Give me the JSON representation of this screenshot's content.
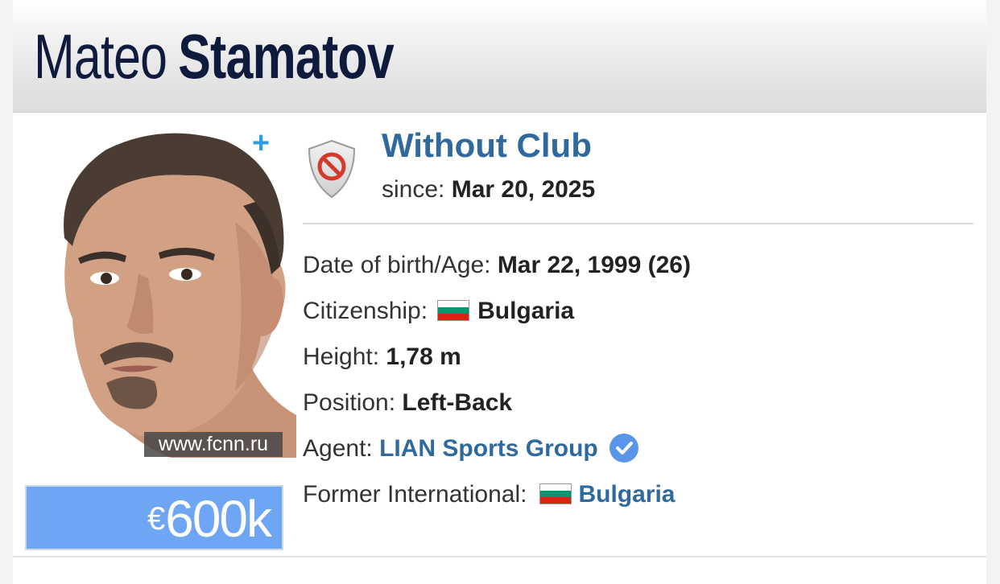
{
  "player": {
    "first_name": "Mateo",
    "last_name": "Stamatov"
  },
  "photo": {
    "watermark": "www.fcnn.ru",
    "plus_label": "+"
  },
  "market_value": {
    "currency": "€",
    "amount": "600k"
  },
  "club": {
    "name": "Without Club",
    "since_label": "since:",
    "since_value": "Mar 20, 2025",
    "icon": "no-club-shield-icon"
  },
  "details": {
    "birth_label": "Date of birth/Age:",
    "birth_value": "Mar 22, 1999 (26)",
    "citizenship_label": "Citizenship:",
    "citizenship_value": "Bulgaria",
    "height_label": "Height:",
    "height_value": "1,78 m",
    "position_label": "Position:",
    "position_value": "Left-Back",
    "agent_label": "Agent:",
    "agent_value": "LIAN Sports Group",
    "former_label": "Former International:",
    "former_value": "Bulgaria"
  },
  "colors": {
    "link": "#2f6a9f",
    "value_box": "#6ea6f4",
    "plus": "#2d9ee0",
    "verified": "#5b95ea"
  }
}
